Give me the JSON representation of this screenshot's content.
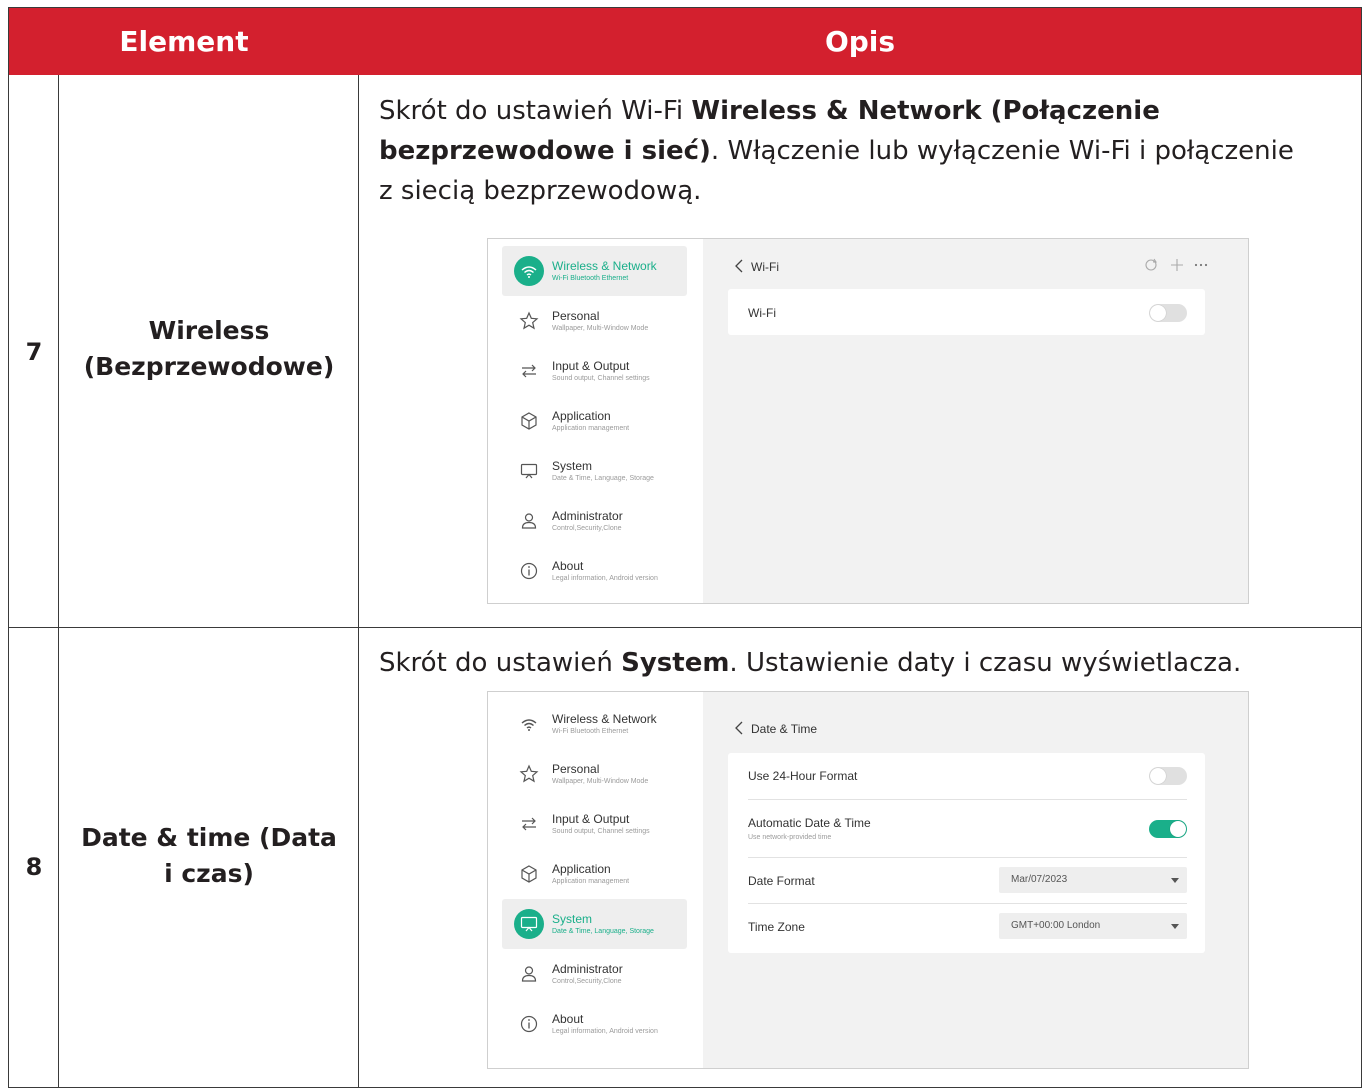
{
  "table": {
    "headers": {
      "element": "Element",
      "opis": "Opis"
    },
    "rows": [
      {
        "number": "7",
        "name_line1": "Wireless",
        "name_line2": "(Bezprzewodowe)",
        "desc": {
          "l1_a": "Skrót do ustawień Wi-Fi ",
          "l1_b": "Wireless & Network (Połączenie",
          "l2_b": "bezprzewodowe i sieć)",
          "l2_a": ". Włączenie lub wyłączenie Wi-Fi i połączenie",
          "l3": "z siecią bezprzewodową."
        }
      },
      {
        "number": "8",
        "name_line1": "Date & time (Data",
        "name_line2": "i czas)",
        "desc": {
          "a": "Skrót do ustawień ",
          "b": "System",
          "c": ". Ustawienie daty i czasu wyświetlacza."
        }
      }
    ]
  },
  "nav": [
    {
      "title": "Wireless & Network",
      "subtitle": "Wi-Fi Bluetooth Ethernet",
      "icon": "wifi-icon"
    },
    {
      "title": "Personal",
      "subtitle": "Wallpaper, Multi-Window Mode",
      "icon": "star-icon"
    },
    {
      "title": "Input & Output",
      "subtitle": "Sound output, Channel settings",
      "icon": "swap-arrows-icon"
    },
    {
      "title": "Application",
      "subtitle": "Application management",
      "icon": "cube-icon"
    },
    {
      "title": "System",
      "subtitle": "Date & Time, Language, Storage",
      "icon": "monitor-icon"
    },
    {
      "title": "Administrator",
      "subtitle": "Control,Security,Clone",
      "icon": "user-icon"
    },
    {
      "title": "About",
      "subtitle": "Legal information, Android version",
      "icon": "info-icon"
    }
  ],
  "wifi_screen": {
    "active_nav": "Wireless & Network",
    "back_label": "Wi-Fi",
    "toolbar_icons": [
      "refresh-icon",
      "plus-icon",
      "more-icon"
    ],
    "wifi_label": "Wi-Fi",
    "wifi_toggle": "off"
  },
  "datetime_screen": {
    "active_nav": "System",
    "back_label": "Date & Time",
    "use24_label": "Use 24-Hour Format",
    "use24_toggle": "off",
    "auto_label": "Automatic Date & Time",
    "auto_sub": "Use network-provided time",
    "auto_toggle": "on",
    "date_format_label": "Date Format",
    "date_format_value": "Mar/07/2023",
    "time_zone_label": "Time Zone",
    "time_zone_value": "GMT+00:00 London"
  },
  "colors": {
    "header_red": "#d3202e",
    "accent_teal": "#1aaf8a"
  }
}
